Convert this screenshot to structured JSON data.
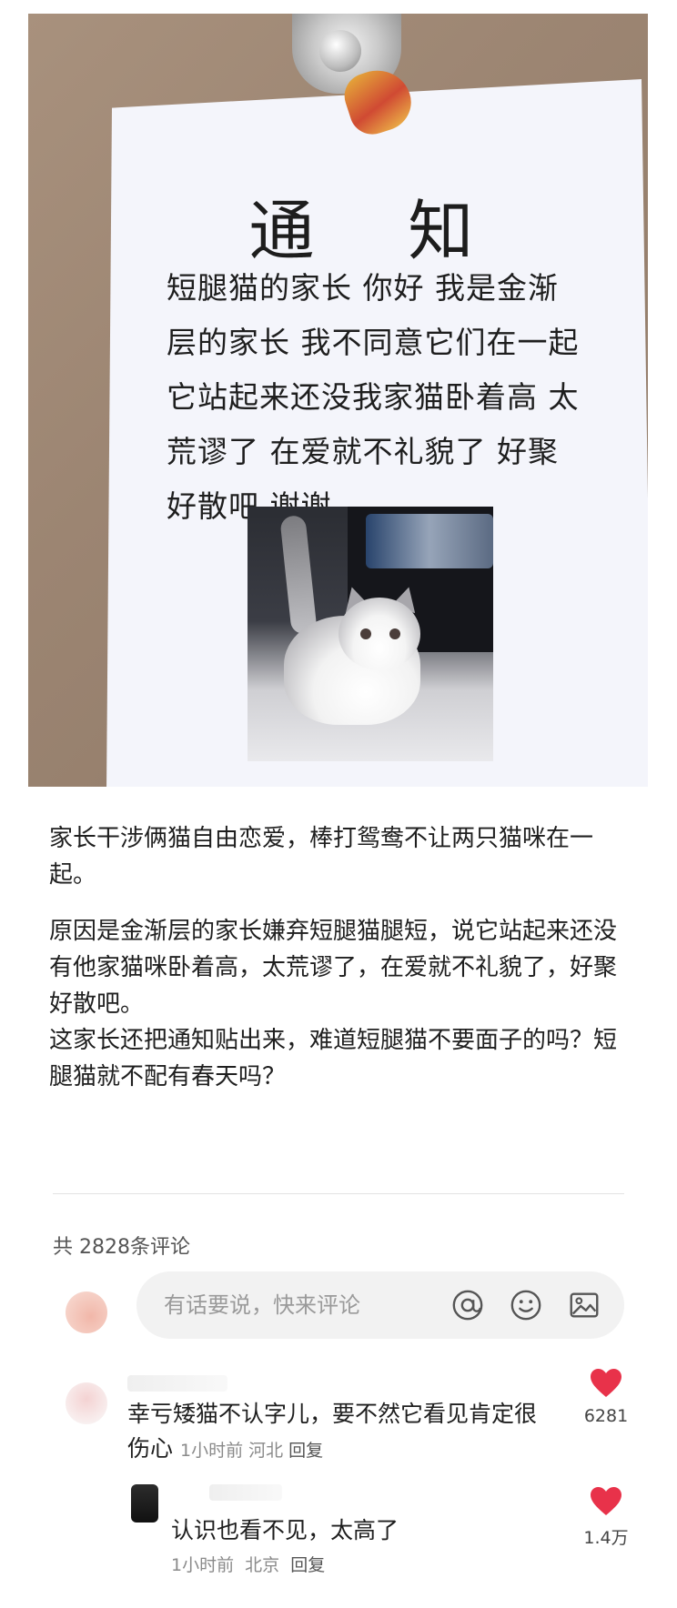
{
  "notice": {
    "title": "通 知",
    "lines": [
      "短腿猫的家长 你好 我是金渐",
      "层的家长 我不同意它们在一起",
      "它站起来还没我家猫卧着高 太",
      "荒谬了 在爱就不礼貌了 好聚",
      "好散吧 谢谢"
    ]
  },
  "article": {
    "p1": "家长干涉俩猫自由恋爱，棒打鸳鸯不让两只猫咪在一起。",
    "p2": "原因是金渐层的家长嫌弃短腿猫腿短，说它站起来还没有他家猫咪卧着高，太荒谬了，在爱就不礼貌了，好聚好散吧。",
    "p3": "这家长还把通知贴出来，难道短腿猫不要面子的吗？短腿猫就不配有春天吗？"
  },
  "comments_section": {
    "count_label": "共 2828条评论",
    "input_placeholder": "有话要说，快来评论",
    "accent_color": "#e8324a"
  },
  "comments": [
    {
      "text": "幸亏矮猫不认字儿，要不然它看见肯定很伤心",
      "time": "1小时前",
      "location": "河北",
      "reply": "回复",
      "likes": "6281",
      "liked": true
    },
    {
      "text": "认识也看不见，太高了",
      "time": "1小时前",
      "location": "北京",
      "reply": "回复",
      "likes": "1.4万",
      "liked": true
    }
  ]
}
